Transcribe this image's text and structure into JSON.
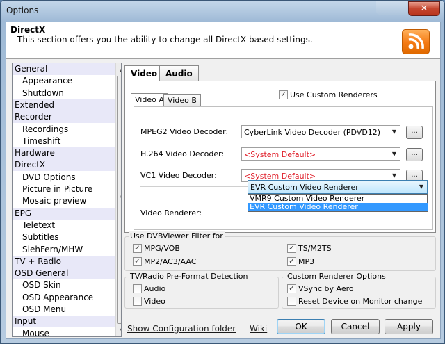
{
  "window": {
    "title": "Options",
    "close_glyph": "✕"
  },
  "header": {
    "title": "DirectX",
    "description": "This section offers you the ability to change all DirectX based settings.",
    "icon": "rss-icon"
  },
  "tree": {
    "items": [
      {
        "label": "General",
        "level": 0
      },
      {
        "label": "Appearance",
        "level": 1
      },
      {
        "label": "Shutdown",
        "level": 1
      },
      {
        "label": "Extended",
        "level": 0
      },
      {
        "label": "Recorder",
        "level": 0
      },
      {
        "label": "Recordings",
        "level": 1
      },
      {
        "label": "Timeshift",
        "level": 1
      },
      {
        "label": "Hardware",
        "level": 0
      },
      {
        "label": "DirectX",
        "level": 0
      },
      {
        "label": "DVD Options",
        "level": 1
      },
      {
        "label": "Picture in Picture",
        "level": 1
      },
      {
        "label": "Mosaic preview",
        "level": 1
      },
      {
        "label": "EPG",
        "level": 0
      },
      {
        "label": "Teletext",
        "level": 1
      },
      {
        "label": "Subtitles",
        "level": 1
      },
      {
        "label": "SiehFern/MHW",
        "level": 1
      },
      {
        "label": "TV + Radio",
        "level": 0
      },
      {
        "label": "OSD General",
        "level": 0
      },
      {
        "label": "OSD Skin",
        "level": 1
      },
      {
        "label": "OSD Appearance",
        "level": 1
      },
      {
        "label": "OSD Menu",
        "level": 1
      },
      {
        "label": "Input",
        "level": 0
      },
      {
        "label": "Mouse",
        "level": 1
      }
    ]
  },
  "tabs": {
    "video": "Video",
    "audio": "Audio",
    "video_a": "Video A",
    "video_b": "Video B"
  },
  "use_custom_renderers": {
    "label": "Use Custom Renderers",
    "checked": true
  },
  "decoders": {
    "mpeg2": {
      "label": "MPEG2 Video Decoder:",
      "value": "CyberLink Video Decoder (PDVD12)"
    },
    "h264": {
      "label": "H.264 Video Decoder:",
      "value": "<System Default>"
    },
    "vc1": {
      "label": "VC1 Video Decoder:",
      "value": "<System Default>"
    },
    "dots": "..."
  },
  "renderer": {
    "label": "Video Renderer:",
    "value": "EVR Custom Video Renderer",
    "options": [
      "VMR9 Custom Video Renderer",
      "EVR Custom Video Renderer"
    ],
    "selected_index": 1
  },
  "dvbviewer_filter": {
    "title": "Use DVBViewer Filter for",
    "items": [
      {
        "label": "MPG/VOB",
        "checked": true
      },
      {
        "label": "TS/M2TS",
        "checked": true
      },
      {
        "label": "MP2/AC3/AAC",
        "checked": true
      },
      {
        "label": "MP3",
        "checked": true
      }
    ]
  },
  "preformat": {
    "title": "TV/Radio Pre-Format Detection",
    "audio": "Audio",
    "video": "Video"
  },
  "custom_renderer_options": {
    "title": "Custom Renderer Options",
    "vsync": "VSync by Aero",
    "reset": "Reset Device on Monitor change"
  },
  "footer": {
    "show_config": "Show Configuration folder",
    "wiki": "Wiki",
    "ok": "OK",
    "cancel": "Cancel",
    "apply": "Apply"
  },
  "colors": {
    "accent": "#3399ff",
    "warning_text": "#e0202b",
    "icon_orange": "#f47a14"
  }
}
